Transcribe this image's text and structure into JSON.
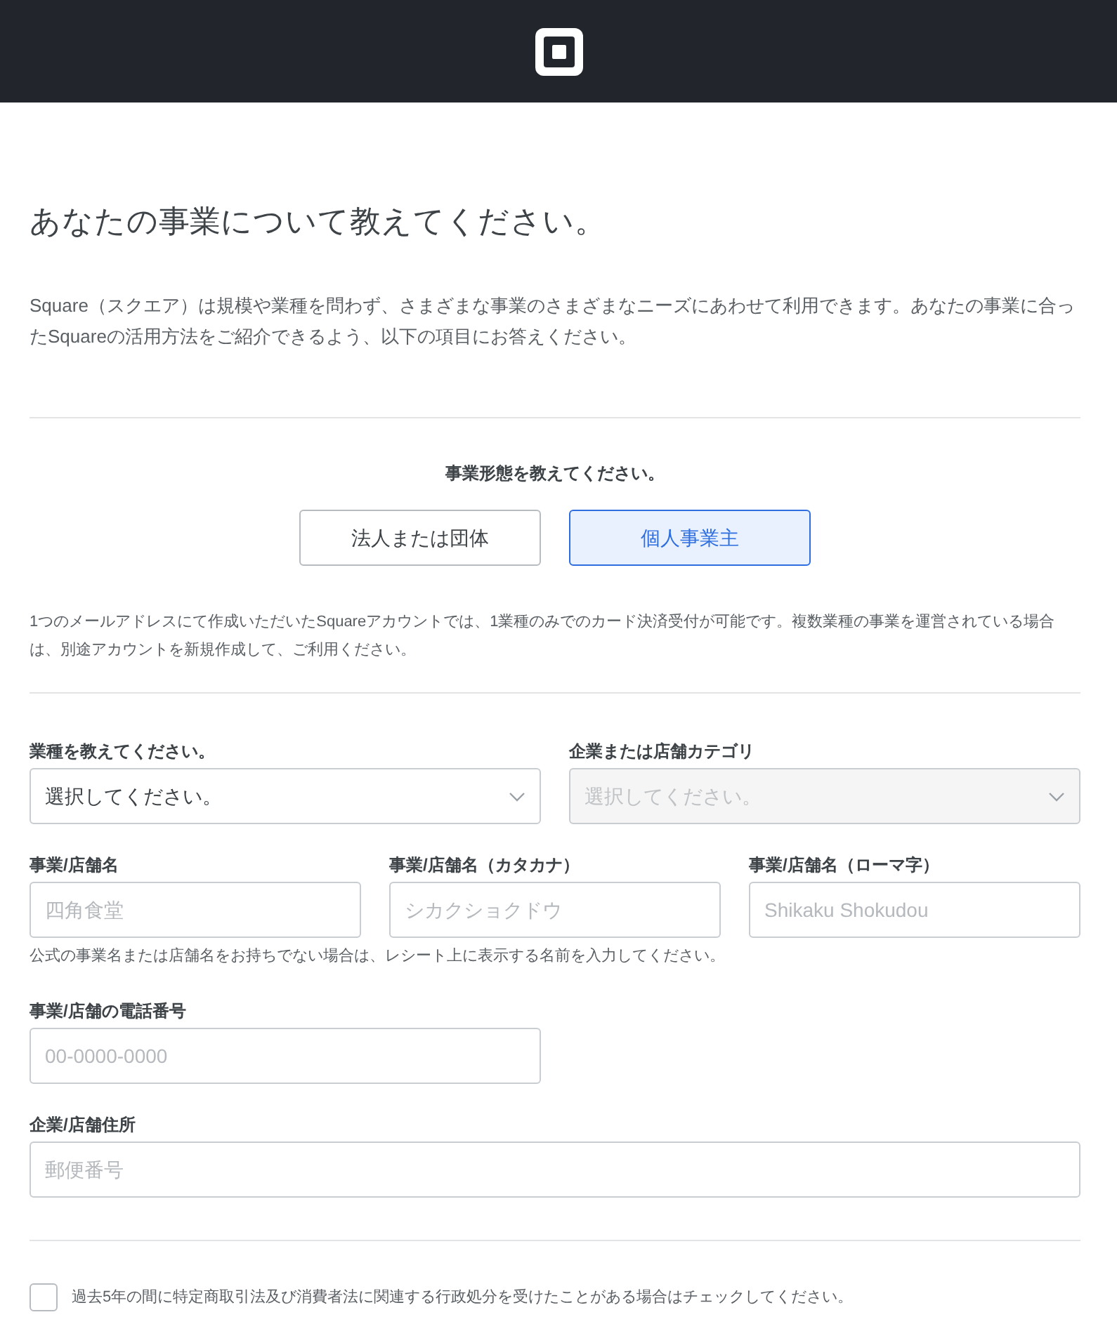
{
  "heading": "あなたの事業について教えてください。",
  "intro": "Square（スクエア）は規模や業種を問わず、さまざまな事業のさまざまなニーズにあわせて利用できます。あなたの事業に合ったSquareの活用方法をご紹介できるよう、以下の項目にお答えください。",
  "business_form": {
    "label": "事業形態を教えてください。",
    "options": [
      {
        "label": "法人または団体",
        "selected": false
      },
      {
        "label": "個人事業主",
        "selected": true
      }
    ]
  },
  "note": "1つのメールアドレスにて作成いただいたSquareアカウントでは、1業種のみでのカード決済受付が可能です。複数業種の事業を運営されている場合は、別途アカウントを新規作成して、ご利用ください。",
  "selects": [
    {
      "label": "業種を教えてください。",
      "value": "選択してください。",
      "disabled": false
    },
    {
      "label": "企業または店舗カテゴリ",
      "value": "選択してください。",
      "disabled": true
    }
  ],
  "name_fields": [
    {
      "label": "事業/店舗名",
      "placeholder": "四角食堂"
    },
    {
      "label": "事業/店舗名（カタカナ）",
      "placeholder": "シカクショクドウ"
    },
    {
      "label": "事業/店舗名（ローマ字）",
      "placeholder": "Shikaku Shokudou"
    }
  ],
  "name_hint": "公式の事業名または店舗名をお持ちでない場合は、レシート上に表示する名前を入力してください。",
  "phone": {
    "label": "事業/店舗の電話番号",
    "placeholder": "00-0000-0000"
  },
  "address": {
    "label": "企業/店舗住所",
    "placeholder": "郵便番号"
  },
  "consent": {
    "label": "過去5年の間に特定商取引法及び消費者法に関連する行政処分を受けたことがある場合はチェックしてください。",
    "checked": false
  }
}
